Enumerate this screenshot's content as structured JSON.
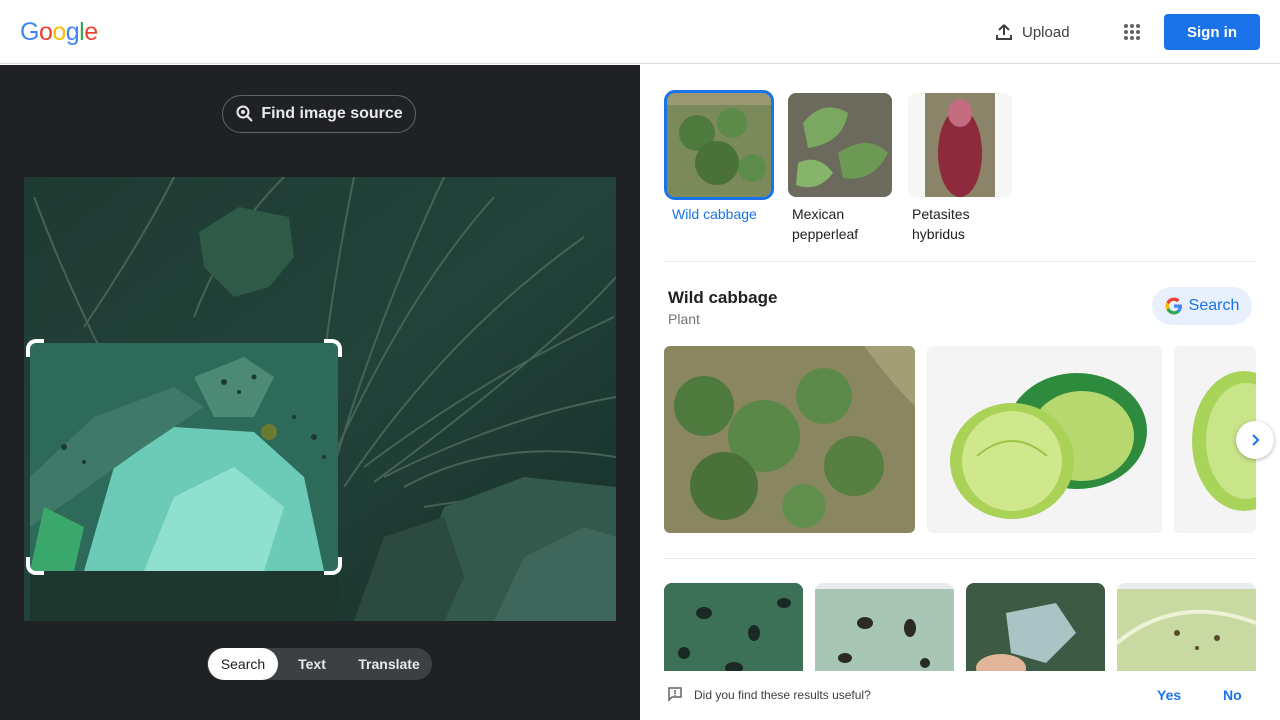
{
  "header": {
    "logo_letters": [
      "G",
      "o",
      "o",
      "g",
      "l",
      "e"
    ],
    "logo_colors": [
      "#4285f4",
      "#ea4335",
      "#fbbc05",
      "#4285f4",
      "#34a853",
      "#ea4335"
    ],
    "upload_label": "Upload",
    "signin_label": "Sign in"
  },
  "left_panel": {
    "find_source_label": "Find image source",
    "modes": [
      {
        "label": "Search",
        "active": true
      },
      {
        "label": "Text",
        "active": false
      },
      {
        "label": "Translate",
        "active": false
      }
    ]
  },
  "right_panel": {
    "suggestions": [
      {
        "label": "Wild cabbage",
        "selected": true
      },
      {
        "label": "Mexican pepperleaf",
        "selected": false
      },
      {
        "label": "Petasites hybridus",
        "selected": false
      }
    ],
    "knowledge": {
      "title": "Wild cabbage",
      "subtitle": "Plant",
      "search_label": "Search"
    },
    "feedback": {
      "question": "Did you find these results useful?",
      "yes": "Yes",
      "no": "No"
    }
  },
  "colors": {
    "accent": "#1a73e8",
    "left_bg": "#202124"
  }
}
